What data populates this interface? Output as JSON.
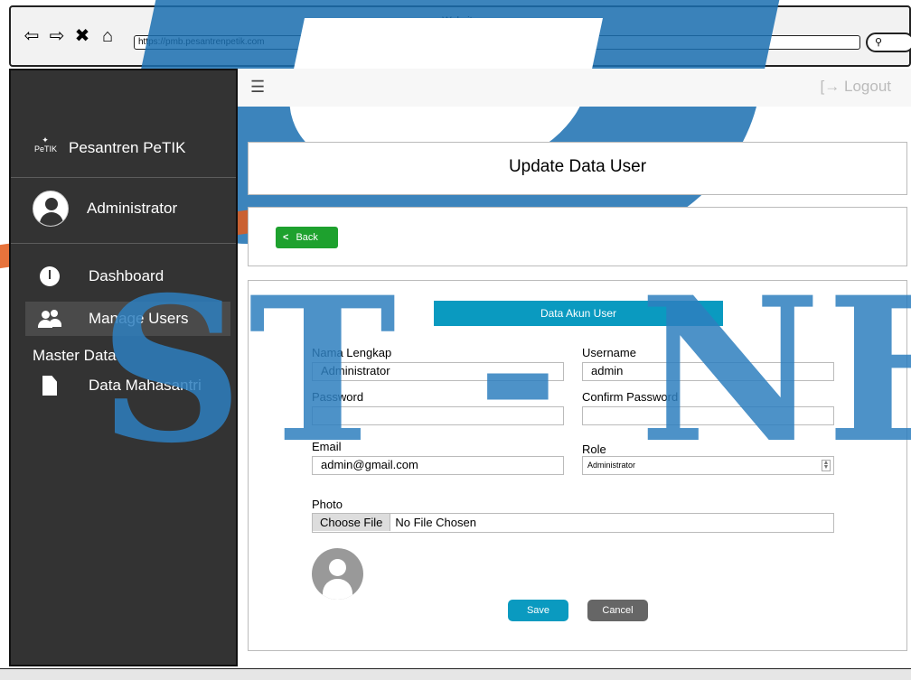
{
  "browser": {
    "title": "Website",
    "url": "https://pmb.pesantrenpetik.com",
    "nav_icons": [
      "arrow-left-icon",
      "arrow-right-icon",
      "close-icon",
      "home-icon"
    ],
    "search_icon": "search-icon"
  },
  "watermark": {
    "text": "ST - NF"
  },
  "sidebar": {
    "brand": {
      "logo_text": "PeTIK",
      "name": "Pesantren PeTIK"
    },
    "user": {
      "name": "Administrator"
    },
    "items": [
      {
        "label": "Dashboard",
        "icon": "dashboard-icon",
        "active": false
      },
      {
        "label": "Manage Users",
        "icon": "users-icon",
        "active": true
      }
    ],
    "section_label": "Master Data",
    "master_items": [
      {
        "label": "Data Mahasantri",
        "icon": "file-icon"
      }
    ]
  },
  "topbar": {
    "menu_icon": "hamburger-icon",
    "logout_label": "Logout",
    "logout_icon": "logout-icon"
  },
  "page": {
    "title": "Update Data User"
  },
  "actions": {
    "back_label": "Back"
  },
  "form": {
    "section_title": "Data Akun User",
    "fields": {
      "nama_lengkap": {
        "label": "Nama Lengkap",
        "value": "Administrator"
      },
      "username": {
        "label": "Username",
        "value": "admin"
      },
      "password": {
        "label": "Password",
        "value": ""
      },
      "confirm_password": {
        "label": "Confirm Password",
        "value": ""
      },
      "email": {
        "label": "Email",
        "value": "admin@gmail.com"
      },
      "role": {
        "label": "Role",
        "value": "Administrator"
      },
      "photo": {
        "label": "Photo",
        "button": "Choose File",
        "status": "No File Chosen"
      }
    },
    "save_label": "Save",
    "cancel_label": "Cancel"
  },
  "colors": {
    "sidebar_bg": "#333333",
    "back_button": "#1ea12e",
    "primary": "#0a9ac0",
    "cancel_button": "#666666"
  }
}
